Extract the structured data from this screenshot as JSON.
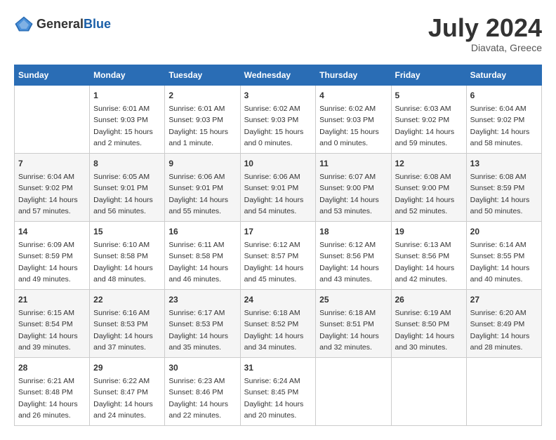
{
  "header": {
    "logo_general": "General",
    "logo_blue": "Blue",
    "month_year": "July 2024",
    "location": "Diavata, Greece"
  },
  "days_of_week": [
    "Sunday",
    "Monday",
    "Tuesday",
    "Wednesday",
    "Thursday",
    "Friday",
    "Saturday"
  ],
  "weeks": [
    [
      {
        "day": "",
        "content": ""
      },
      {
        "day": "1",
        "content": "Sunrise: 6:01 AM\nSunset: 9:03 PM\nDaylight: 15 hours\nand 2 minutes."
      },
      {
        "day": "2",
        "content": "Sunrise: 6:01 AM\nSunset: 9:03 PM\nDaylight: 15 hours\nand 1 minute."
      },
      {
        "day": "3",
        "content": "Sunrise: 6:02 AM\nSunset: 9:03 PM\nDaylight: 15 hours\nand 0 minutes."
      },
      {
        "day": "4",
        "content": "Sunrise: 6:02 AM\nSunset: 9:03 PM\nDaylight: 15 hours\nand 0 minutes."
      },
      {
        "day": "5",
        "content": "Sunrise: 6:03 AM\nSunset: 9:02 PM\nDaylight: 14 hours\nand 59 minutes."
      },
      {
        "day": "6",
        "content": "Sunrise: 6:04 AM\nSunset: 9:02 PM\nDaylight: 14 hours\nand 58 minutes."
      }
    ],
    [
      {
        "day": "7",
        "content": "Sunrise: 6:04 AM\nSunset: 9:02 PM\nDaylight: 14 hours\nand 57 minutes."
      },
      {
        "day": "8",
        "content": "Sunrise: 6:05 AM\nSunset: 9:01 PM\nDaylight: 14 hours\nand 56 minutes."
      },
      {
        "day": "9",
        "content": "Sunrise: 6:06 AM\nSunset: 9:01 PM\nDaylight: 14 hours\nand 55 minutes."
      },
      {
        "day": "10",
        "content": "Sunrise: 6:06 AM\nSunset: 9:01 PM\nDaylight: 14 hours\nand 54 minutes."
      },
      {
        "day": "11",
        "content": "Sunrise: 6:07 AM\nSunset: 9:00 PM\nDaylight: 14 hours\nand 53 minutes."
      },
      {
        "day": "12",
        "content": "Sunrise: 6:08 AM\nSunset: 9:00 PM\nDaylight: 14 hours\nand 52 minutes."
      },
      {
        "day": "13",
        "content": "Sunrise: 6:08 AM\nSunset: 8:59 PM\nDaylight: 14 hours\nand 50 minutes."
      }
    ],
    [
      {
        "day": "14",
        "content": "Sunrise: 6:09 AM\nSunset: 8:59 PM\nDaylight: 14 hours\nand 49 minutes."
      },
      {
        "day": "15",
        "content": "Sunrise: 6:10 AM\nSunset: 8:58 PM\nDaylight: 14 hours\nand 48 minutes."
      },
      {
        "day": "16",
        "content": "Sunrise: 6:11 AM\nSunset: 8:58 PM\nDaylight: 14 hours\nand 46 minutes."
      },
      {
        "day": "17",
        "content": "Sunrise: 6:12 AM\nSunset: 8:57 PM\nDaylight: 14 hours\nand 45 minutes."
      },
      {
        "day": "18",
        "content": "Sunrise: 6:12 AM\nSunset: 8:56 PM\nDaylight: 14 hours\nand 43 minutes."
      },
      {
        "day": "19",
        "content": "Sunrise: 6:13 AM\nSunset: 8:56 PM\nDaylight: 14 hours\nand 42 minutes."
      },
      {
        "day": "20",
        "content": "Sunrise: 6:14 AM\nSunset: 8:55 PM\nDaylight: 14 hours\nand 40 minutes."
      }
    ],
    [
      {
        "day": "21",
        "content": "Sunrise: 6:15 AM\nSunset: 8:54 PM\nDaylight: 14 hours\nand 39 minutes."
      },
      {
        "day": "22",
        "content": "Sunrise: 6:16 AM\nSunset: 8:53 PM\nDaylight: 14 hours\nand 37 minutes."
      },
      {
        "day": "23",
        "content": "Sunrise: 6:17 AM\nSunset: 8:53 PM\nDaylight: 14 hours\nand 35 minutes."
      },
      {
        "day": "24",
        "content": "Sunrise: 6:18 AM\nSunset: 8:52 PM\nDaylight: 14 hours\nand 34 minutes."
      },
      {
        "day": "25",
        "content": "Sunrise: 6:18 AM\nSunset: 8:51 PM\nDaylight: 14 hours\nand 32 minutes."
      },
      {
        "day": "26",
        "content": "Sunrise: 6:19 AM\nSunset: 8:50 PM\nDaylight: 14 hours\nand 30 minutes."
      },
      {
        "day": "27",
        "content": "Sunrise: 6:20 AM\nSunset: 8:49 PM\nDaylight: 14 hours\nand 28 minutes."
      }
    ],
    [
      {
        "day": "28",
        "content": "Sunrise: 6:21 AM\nSunset: 8:48 PM\nDaylight: 14 hours\nand 26 minutes."
      },
      {
        "day": "29",
        "content": "Sunrise: 6:22 AM\nSunset: 8:47 PM\nDaylight: 14 hours\nand 24 minutes."
      },
      {
        "day": "30",
        "content": "Sunrise: 6:23 AM\nSunset: 8:46 PM\nDaylight: 14 hours\nand 22 minutes."
      },
      {
        "day": "31",
        "content": "Sunrise: 6:24 AM\nSunset: 8:45 PM\nDaylight: 14 hours\nand 20 minutes."
      },
      {
        "day": "",
        "content": ""
      },
      {
        "day": "",
        "content": ""
      },
      {
        "day": "",
        "content": ""
      }
    ]
  ]
}
